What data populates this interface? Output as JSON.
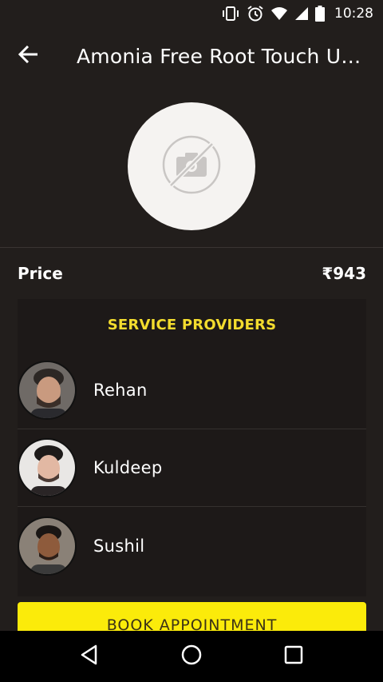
{
  "status_bar": {
    "time": "10:28",
    "icons": [
      "vibrate-icon",
      "alarm-icon",
      "wifi-icon",
      "signal-icon",
      "battery-icon"
    ]
  },
  "app_bar": {
    "title": "Amonia Free Root Touch Up (Loreal Inoa)",
    "back_icon": "arrow-left-icon"
  },
  "product_image": {
    "icon": "no-camera-icon"
  },
  "price": {
    "label": "Price",
    "value": "₹943"
  },
  "providers": {
    "heading": "SERVICE PROVIDERS",
    "items": [
      {
        "name": "Rehan"
      },
      {
        "name": "Kuldeep"
      },
      {
        "name": "Sushil"
      }
    ]
  },
  "book_button": {
    "label": "BOOK APPOINTMENT"
  },
  "nav_bar": {
    "icons": [
      "back-triangle-icon",
      "home-circle-icon",
      "recents-square-icon"
    ]
  },
  "colors": {
    "background": "#221e1c",
    "accent_yellow": "#fbeb0a",
    "heading_yellow": "#f3dc2e"
  }
}
